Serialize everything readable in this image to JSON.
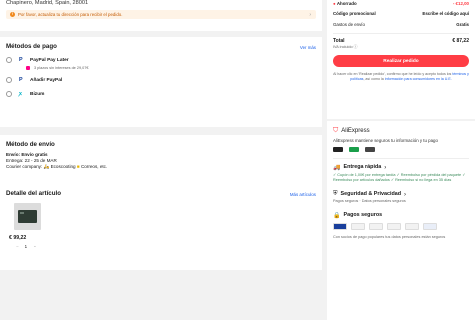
{
  "address": {
    "line": "Chapinero, Madrid, Spain, 28001",
    "warning": "Por favor, actualiza tu dirección para recibir el pedido."
  },
  "payment": {
    "title": "Métodos de pago",
    "see_more": "Ver más",
    "options": [
      {
        "label": "PayPal Pay Later",
        "sub": "3 plazos sin intereses de 29,07€"
      },
      {
        "label": "Añadir PayPal",
        "sub": ""
      },
      {
        "label": "Bizum",
        "sub": ""
      }
    ]
  },
  "shipping": {
    "title": "Método de envío",
    "free": "Envío: Envío gratis",
    "delivery": "Entrega: 22 - 25 de MAR",
    "courier_prefix": "Courier company:",
    "courier_name1": "Ecoscooting",
    "courier_name2": "Correos",
    "courier_suffix": ", etc."
  },
  "items": {
    "title": "Detalle del artículo",
    "more": "Más artículos",
    "price": "€ 99,22",
    "qty": "1"
  },
  "summary": {
    "saved_label": "Ahorrado",
    "saved_value": "- €12,00",
    "promo_label": "Código promocional",
    "promo_value": "Escribe el código aquí",
    "shipping_label": "Gastos de envío",
    "shipping_value": "Gratis",
    "total_label": "Total",
    "total_value": "€ 87,22",
    "vat": "IVA incluido",
    "cta": "Realizar pedido",
    "legal_1": "Al hacer clic en 'Realizar pedido', confirmo que he leído y acepto todos los ",
    "legal_link1": "términos y políticas",
    "legal_2": ", así como la ",
    "legal_link2": "información para consumidores en la U.E."
  },
  "aliexpress": {
    "brand": "AliExpress",
    "tagline": "AliExpress mantiene seguros tu información y tu pago",
    "fast_title": "Entrega rápida",
    "fast_items": "✓ Cupón de 1,00€ por entrega tardía  ✓ Reembolso por pérdida del paquete  ✓ Reembolso por artículos dañados  ✓ Reembolso si no llega en 35 días",
    "security_title": "Seguridad & Privacidad",
    "security_sub": "Pagos seguros · Datos personales seguros",
    "payments_title": "Pagos seguros",
    "payments_sub": "Con socios de pago populares tus datos personales están seguros"
  },
  "colors": {
    "accent": "#ff3d45",
    "link": "#1a5fe8",
    "success": "#1a9e4a"
  }
}
